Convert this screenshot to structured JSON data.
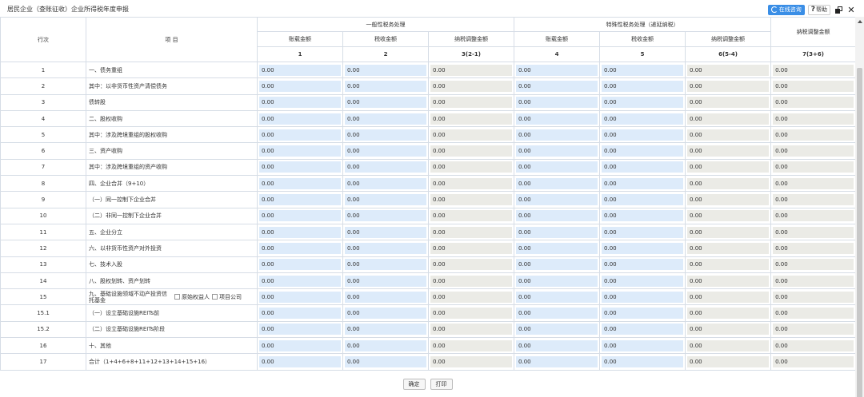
{
  "title": "居民企业（查账征收）企业所得税年度申报",
  "toolbar": {
    "online_label": "在线咨询",
    "help_label": "帮助",
    "help_icon": "?"
  },
  "header": {
    "row_label": "行次",
    "item_label": "项 目",
    "general_group": "一般性税务处理",
    "special_group": "特殊性税务处理（递延纳税）",
    "adjust_label": "纳税调整金额",
    "columns": [
      "账载金额",
      "税收金额",
      "纳税调整金额",
      "账载金额",
      "税收金额",
      "纳税调整金额"
    ],
    "col_numbers": [
      "1",
      "2",
      "3(2-1)",
      "4",
      "5",
      "6(5-4)",
      "7(3+6)"
    ]
  },
  "rows": [
    {
      "idx": "1",
      "item": "一、债务重组",
      "values": [
        "0.00",
        "0.00",
        "0.00",
        "0.00",
        "0.00",
        "0.00",
        "0.00"
      ]
    },
    {
      "idx": "2",
      "item": "其中：以非货币性资产清偿债务",
      "values": [
        "0.00",
        "0.00",
        "0.00",
        "0.00",
        "0.00",
        "0.00",
        "0.00"
      ]
    },
    {
      "idx": "3",
      "item": "债转股",
      "values": [
        "0.00",
        "0.00",
        "0.00",
        "0.00",
        "0.00",
        "0.00",
        "0.00"
      ]
    },
    {
      "idx": "4",
      "item": "二、股权收购",
      "values": [
        "0.00",
        "0.00",
        "0.00",
        "0.00",
        "0.00",
        "0.00",
        "0.00"
      ]
    },
    {
      "idx": "5",
      "item": "其中：涉及跨境重组的股权收购",
      "values": [
        "0.00",
        "0.00",
        "0.00",
        "0.00",
        "0.00",
        "0.00",
        "0.00"
      ]
    },
    {
      "idx": "6",
      "item": "三、资产收购",
      "values": [
        "0.00",
        "0.00",
        "0.00",
        "0.00",
        "0.00",
        "0.00",
        "0.00"
      ]
    },
    {
      "idx": "7",
      "item": "其中：涉及跨境重组的资产收购",
      "values": [
        "0.00",
        "0.00",
        "0.00",
        "0.00",
        "0.00",
        "0.00",
        "0.00"
      ]
    },
    {
      "idx": "8",
      "item": "四、企业合并（9+10）",
      "values": [
        "0.00",
        "0.00",
        "0.00",
        "0.00",
        "0.00",
        "0.00",
        "0.00"
      ]
    },
    {
      "idx": "9",
      "item": "（一）同一控制下企业合并",
      "values": [
        "0.00",
        "0.00",
        "0.00",
        "0.00",
        "0.00",
        "0.00",
        "0.00"
      ]
    },
    {
      "idx": "10",
      "item": "（二）非同一控制下企业合并",
      "values": [
        "0.00",
        "0.00",
        "0.00",
        "0.00",
        "0.00",
        "0.00",
        "0.00"
      ]
    },
    {
      "idx": "11",
      "item": "五、企业分立",
      "values": [
        "0.00",
        "0.00",
        "0.00",
        "0.00",
        "0.00",
        "0.00",
        "0.00"
      ]
    },
    {
      "idx": "12",
      "item": "六、以非货币性资产对外投资",
      "values": [
        "0.00",
        "0.00",
        "0.00",
        "0.00",
        "0.00",
        "0.00",
        "0.00"
      ]
    },
    {
      "idx": "13",
      "item": "七、技术入股",
      "values": [
        "0.00",
        "0.00",
        "0.00",
        "0.00",
        "0.00",
        "0.00",
        "0.00"
      ]
    },
    {
      "idx": "14",
      "item": "八、股权划转、资产划转",
      "values": [
        "0.00",
        "0.00",
        "0.00",
        "0.00",
        "0.00",
        "0.00",
        "0.00"
      ]
    },
    {
      "idx": "15",
      "item": "九、基础设施领域不动产投资信托基金",
      "values": [
        "0.00",
        "0.00",
        "0.00",
        "0.00",
        "0.00",
        "0.00",
        "0.00"
      ]
    },
    {
      "idx": "15.1",
      "item": "（一）设立基础设施REITs前",
      "values": [
        "0.00",
        "0.00",
        "0.00",
        "0.00",
        "0.00",
        "0.00",
        "0.00"
      ]
    },
    {
      "idx": "15.2",
      "item": "（二）设立基础设施REITs阶段",
      "values": [
        "0.00",
        "0.00",
        "0.00",
        "0.00",
        "0.00",
        "0.00",
        "0.00"
      ]
    },
    {
      "idx": "16",
      "item": "十、其他",
      "values": [
        "0.00",
        "0.00",
        "0.00",
        "0.00",
        "0.00",
        "0.00",
        "0.00"
      ]
    },
    {
      "idx": "17",
      "item": "合计（1+4+6+8+11+12+13+14+15+16）",
      "values": [
        "0.00",
        "0.00",
        "0.00",
        "0.00",
        "0.00",
        "0.00",
        "0.00"
      ]
    }
  ],
  "row15_options": [
    "原始权益人",
    "项目公司"
  ],
  "footer": {
    "confirm_label": "确定",
    "print_label": "打印"
  },
  "colors": {
    "editable_cell": "#ddebfa",
    "readonly_cell": "#ebebe6",
    "accent": "#3a8ee6"
  }
}
